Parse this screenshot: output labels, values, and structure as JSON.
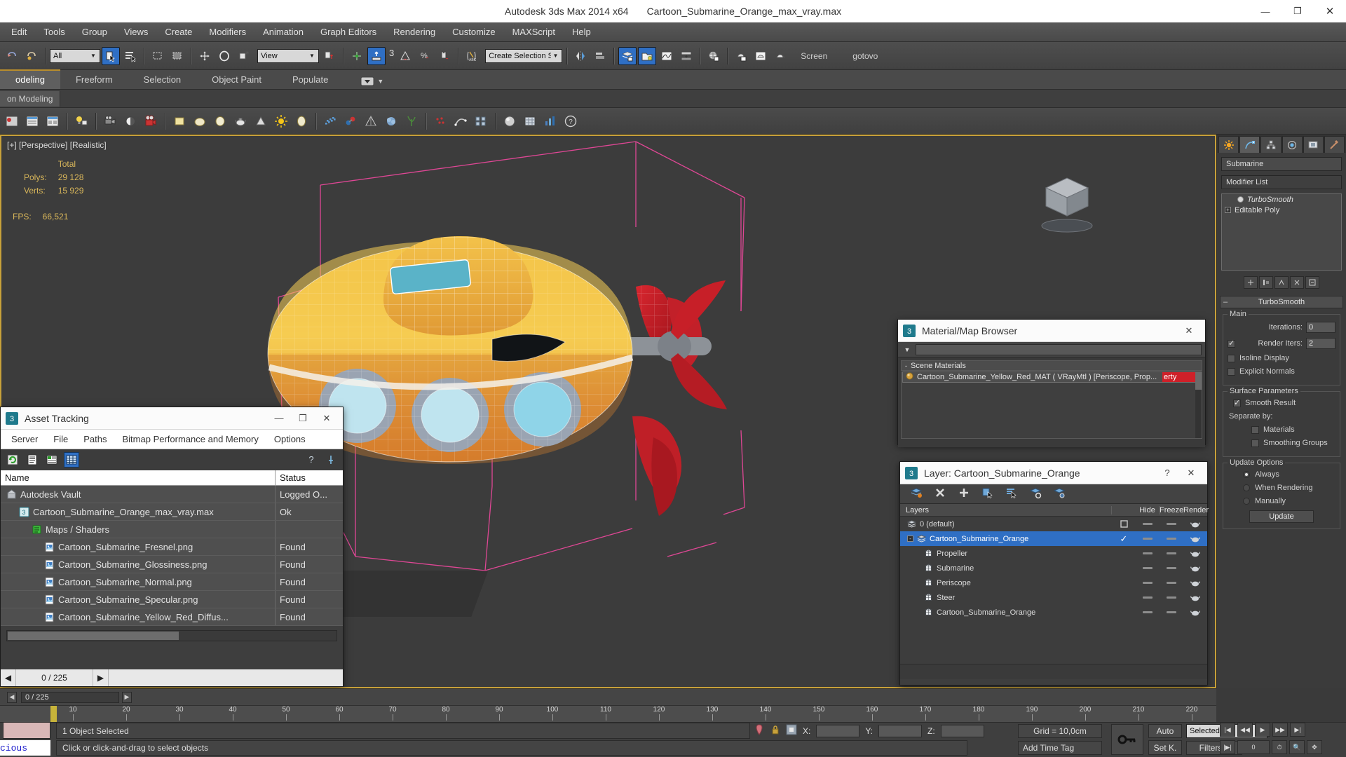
{
  "titlebar": {
    "app_title": "Autodesk 3ds Max  2014 x64",
    "file_title": "Cartoon_Submarine_Orange_max_vray.max",
    "minimize": "—",
    "restore": "❐",
    "close": "✕"
  },
  "menubar": {
    "items": [
      "Edit",
      "Tools",
      "Group",
      "Views",
      "Create",
      "Modifiers",
      "Animation",
      "Graph Editors",
      "Rendering",
      "Customize",
      "MAXScript",
      "Help"
    ]
  },
  "toolbar": {
    "selection_filter": "All",
    "reference_coord": "View",
    "named_selection_set": "Create Selection S",
    "snap_count": "3",
    "screen_label": "Screen",
    "gotovo_label": "gotovo"
  },
  "ribbon": {
    "tabs": [
      "odeling",
      "Freeform",
      "Selection",
      "Object Paint",
      "Populate"
    ],
    "active_tab_index": 0,
    "subtab": "on Modeling"
  },
  "viewport": {
    "label": "[+] [Perspective] [Realistic]",
    "stats_header": "Total",
    "polys_label": "Polys:",
    "polys_value": "29 128",
    "verts_label": "Verts:",
    "verts_value": "15 929",
    "fps_label": "FPS:",
    "fps_value": "66,521"
  },
  "command_panel": {
    "object_name": "Submarine",
    "modifier_list_label": "Modifier List",
    "stack": [
      {
        "label": "TurboSmooth",
        "italic": true
      },
      {
        "label": "Editable Poly",
        "italic": false
      }
    ],
    "rollup_title": "TurboSmooth",
    "main_group": "Main",
    "iterations_label": "Iterations:",
    "iterations_value": "0",
    "render_iters_label": "Render Iters:",
    "render_iters_value": "2",
    "render_iters_checked": true,
    "isoline_display": "Isoline Display",
    "explicit_normals": "Explicit Normals",
    "surface_group": "Surface Parameters",
    "smooth_result": "Smooth Result",
    "separate_by": "Separate by:",
    "materials": "Materials",
    "smoothing_groups": "Smoothing Groups",
    "update_group": "Update Options",
    "update_always": "Always",
    "update_when_rendering": "When Rendering",
    "update_manually": "Manually",
    "update_button": "Update"
  },
  "asset_tracking": {
    "title": "Asset Tracking",
    "menu": [
      "Server",
      "File",
      "Paths",
      "Bitmap Performance and Memory",
      "Options"
    ],
    "columns": [
      "Name",
      "Status"
    ],
    "rows": [
      {
        "name": "Autodesk Vault",
        "status": "Logged O...",
        "indent": 0,
        "icon": "vault-icon"
      },
      {
        "name": "Cartoon_Submarine_Orange_max_vray.max",
        "status": "Ok",
        "indent": 1,
        "icon": "max-file-icon"
      },
      {
        "name": "Maps / Shaders",
        "status": "",
        "indent": 2,
        "icon": "maps-icon"
      },
      {
        "name": "Cartoon_Submarine_Fresnel.png",
        "status": "Found",
        "indent": 3,
        "icon": "image-icon"
      },
      {
        "name": "Cartoon_Submarine_Glossiness.png",
        "status": "Found",
        "indent": 3,
        "icon": "image-icon"
      },
      {
        "name": "Cartoon_Submarine_Normal.png",
        "status": "Found",
        "indent": 3,
        "icon": "image-icon"
      },
      {
        "name": "Cartoon_Submarine_Specular.png",
        "status": "Found",
        "indent": 3,
        "icon": "image-icon"
      },
      {
        "name": "Cartoon_Submarine_Yellow_Red_Diffus...",
        "status": "Found",
        "indent": 3,
        "icon": "image-icon"
      }
    ],
    "footer_frame": "0 / 225"
  },
  "material_browser": {
    "title": "Material/Map Browser",
    "close": "✕",
    "section": "Scene Materials",
    "items": [
      {
        "name": "Cartoon_Submarine_Yellow_Red_MAT  ( VRayMtl )  [Periscope, Prop...",
        "truncated_tail": "erty"
      }
    ]
  },
  "layer_window": {
    "title": "Layer: Cartoon_Submarine_Orange",
    "help": "?",
    "close": "✕",
    "columns": [
      "Layers",
      "",
      "Hide",
      "Freeze",
      "Render"
    ],
    "rows": [
      {
        "name": "0 (default)",
        "indent": 0,
        "selected": false,
        "current": false,
        "icon": "layer-icon"
      },
      {
        "name": "Cartoon_Submarine_Orange",
        "indent": 0,
        "selected": true,
        "current": true,
        "icon": "layer-icon"
      },
      {
        "name": "Propeller",
        "indent": 1,
        "selected": false,
        "current": false,
        "icon": "object-icon"
      },
      {
        "name": "Submarine",
        "indent": 1,
        "selected": false,
        "current": false,
        "icon": "object-icon"
      },
      {
        "name": "Periscope",
        "indent": 1,
        "selected": false,
        "current": false,
        "icon": "object-icon"
      },
      {
        "name": "Steer",
        "indent": 1,
        "selected": false,
        "current": false,
        "icon": "object-icon"
      },
      {
        "name": "Cartoon_Submarine_Orange",
        "indent": 1,
        "selected": false,
        "current": false,
        "icon": "object-icon"
      }
    ]
  },
  "timeline": {
    "frame_display": "0 / 225",
    "ticks": [
      "10",
      "20",
      "30",
      "40",
      "50",
      "60",
      "70",
      "80",
      "90",
      "100",
      "110",
      "120",
      "130",
      "140",
      "150",
      "160",
      "170",
      "180",
      "190",
      "200",
      "210",
      "220"
    ]
  },
  "statusbar": {
    "selection_status": "1 Object Selected",
    "prompt": "Click or click-and-drag to select objects",
    "x_label": "X:",
    "y_label": "Y:",
    "z_label": "Z:",
    "x_value": "",
    "y_value": "",
    "z_value": "",
    "grid": "Grid = 10,0cm",
    "time_tag": "Add Time Tag",
    "auto_key": "Auto",
    "set_key": "Set K.",
    "key_filters": "Filters...",
    "selection_mode": "Selected",
    "frame_field": "0",
    "mini_listener": "cious"
  },
  "colors": {
    "accent_blue": "#2f6fc4",
    "viewport_border": "#c8a13a",
    "panel_bg": "#3b3b3b",
    "stat_yellow": "#d8b65a",
    "red_badge": "#cf2029"
  }
}
